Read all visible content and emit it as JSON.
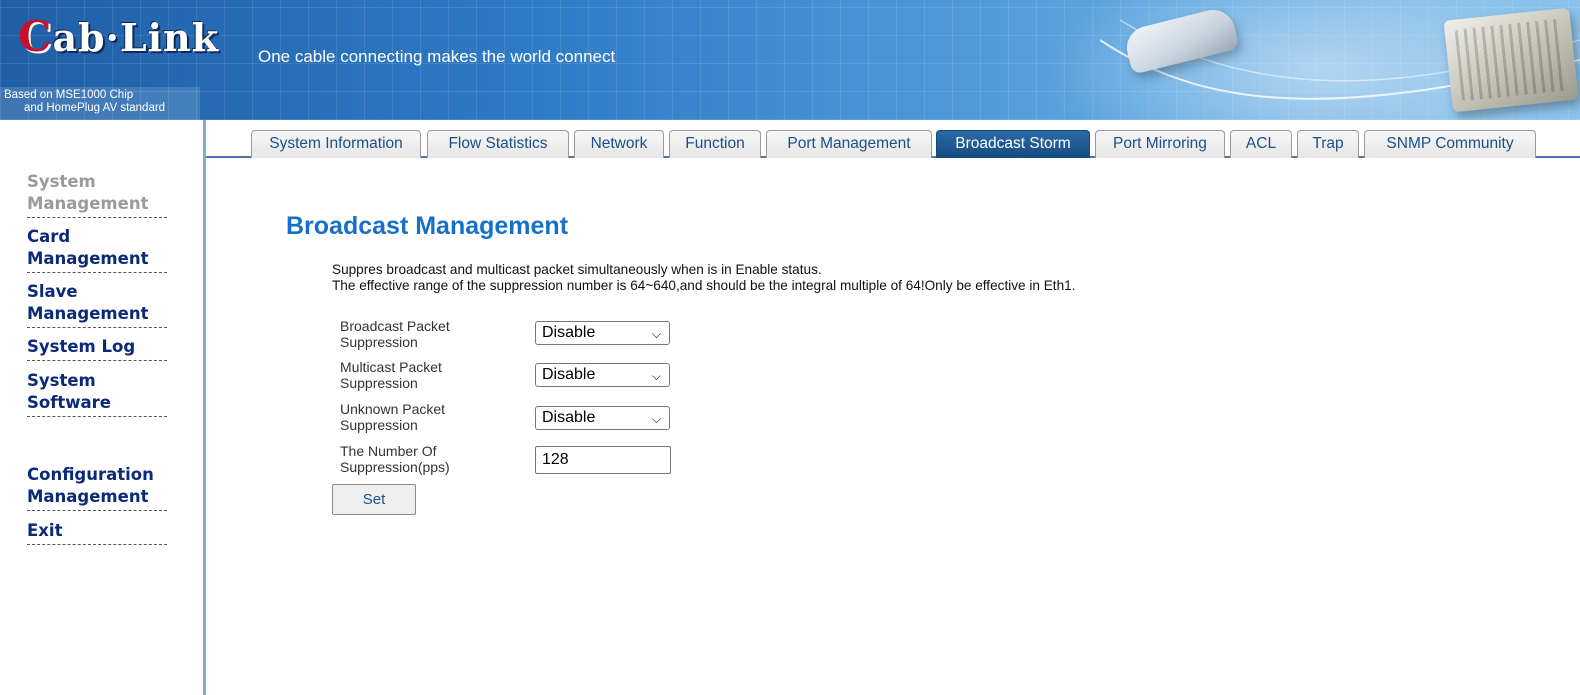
{
  "header": {
    "logo_mark": "C",
    "logo_rest": "ab·Link",
    "tagline": "One cable connecting makes the world connect",
    "chip_line1": "Based on MSE1000 Chip",
    "chip_line2": "and HomePlug AV standard"
  },
  "sidebar": {
    "items": [
      {
        "label1": "System",
        "label2": "Management"
      },
      {
        "label1": "Card",
        "label2": "Management"
      },
      {
        "label1": "Slave",
        "label2": "Management"
      },
      {
        "label1": "System Log",
        "label2": ""
      },
      {
        "label1": "System",
        "label2": "Software"
      },
      {
        "label1": "Configuration",
        "label2": "Management"
      },
      {
        "label1": "Exit",
        "label2": ""
      }
    ]
  },
  "tabs": [
    "System Information",
    "Flow Statistics",
    "Network",
    "Function",
    "Port Management",
    "Broadcast Storm",
    "Port Mirroring",
    "ACL",
    "Trap",
    "SNMP Community"
  ],
  "main": {
    "title": "Broadcast Management",
    "desc_line1": "Suppres broadcast and multicast packet simultaneously when is in Enable status.",
    "desc_line2": "The effective range of the suppression number is 64~640,and should be the integral multiple of 64!Only be effective in Eth1.",
    "fields": [
      {
        "label1": "Broadcast Packet",
        "label2": "Suppression",
        "value": "Disable"
      },
      {
        "label1": "Multicast Packet",
        "label2": "Suppression",
        "value": "Disable"
      },
      {
        "label1": "Unknown Packet",
        "label2": "Suppression",
        "value": "Disable"
      }
    ],
    "number_label1": "The Number Of",
    "number_label2": "Suppression(pps)",
    "number_value": "128",
    "set_label": "Set"
  },
  "colors": {
    "accent": "#1770c7",
    "nav": "#0a2a78",
    "active_tab": "#154a80"
  }
}
